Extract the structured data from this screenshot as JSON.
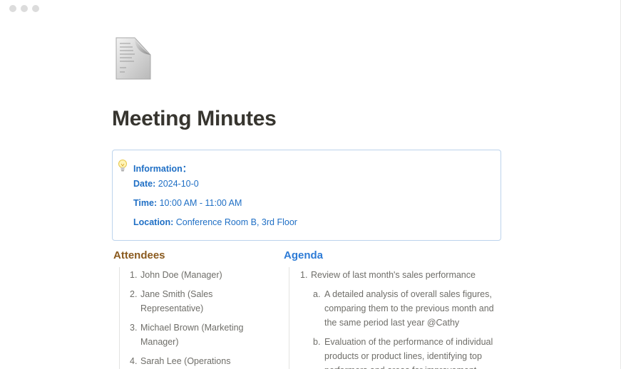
{
  "page": {
    "icon": "document-icon",
    "title": "Meeting Minutes"
  },
  "callout": {
    "icon": "lightbulb-icon",
    "header": "Information：",
    "date_label": "Date:",
    "date_value": "2024-10-0",
    "time_label": "Time:",
    "time_value": "10:00 AM - 11:00 AM",
    "location_label": "Location:",
    "location_value": "Conference Room B, 3rd Floor"
  },
  "attendees": {
    "heading": "Attendees",
    "items": [
      {
        "num": "1.",
        "line1": "John Doe (Manager)",
        "line2": ""
      },
      {
        "num": "2.",
        "line1": "Jane Smith (Sales",
        "line2": "Representative)"
      },
      {
        "num": "3.",
        "line1": "Michael Brown (Marketing",
        "line2": "Manager)"
      },
      {
        "num": "4.",
        "line1": "Sarah Lee (Operations",
        "line2": ""
      }
    ]
  },
  "agenda": {
    "heading": "Agenda",
    "items": [
      {
        "num": "1.",
        "text": "Review of last month's sales performance"
      }
    ],
    "subitems": [
      {
        "num": "a.",
        "line1": "A detailed analysis of overall sales figures,",
        "line2": "comparing them to the previous month and",
        "line3": "the same period last year @Cathy"
      },
      {
        "num": "b.",
        "line1": "Evaluation of the performance of individual",
        "line2": "products or product lines, identifying top",
        "line3": "performers and areas for improvement"
      }
    ]
  },
  "colors": {
    "callout_text": "#1f6fc5",
    "attendees_heading": "#8a5a1e",
    "agenda_heading": "#2d7bd6"
  }
}
